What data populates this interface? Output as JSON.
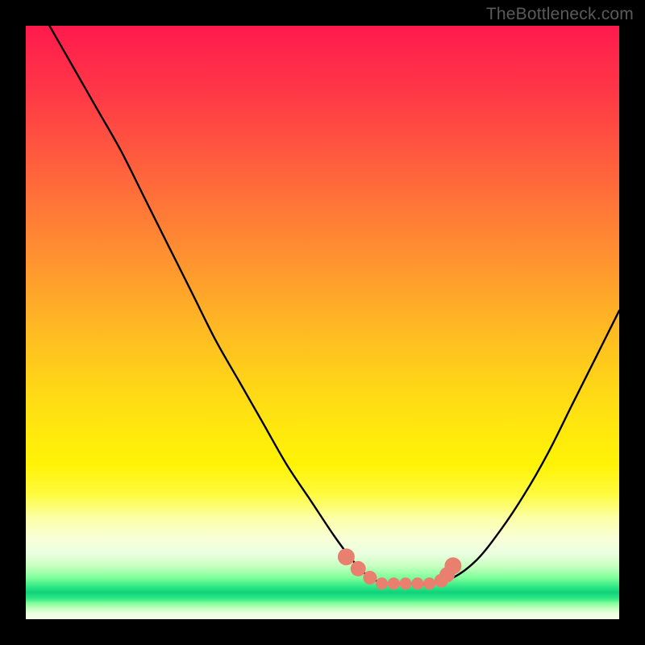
{
  "watermark": "TheBottleneck.com",
  "colors": {
    "frame": "#000000",
    "gradient_top": "#ff1a4d",
    "gradient_mid": "#ffe80e",
    "gradient_green": "#10d27a",
    "curve_stroke": "#000000",
    "dot_fill": "#e9806f"
  },
  "chart_data": {
    "type": "line",
    "title": "",
    "xlabel": "",
    "ylabel": "",
    "xlim": [
      0,
      100
    ],
    "ylim": [
      0,
      100
    ],
    "grid": false,
    "series": [
      {
        "name": "bottleneck-curve",
        "x": [
          4,
          8,
          12,
          16,
          20,
          24,
          28,
          32,
          36,
          40,
          44,
          48,
          52,
          55,
          58,
          61,
          63,
          65,
          68,
          72,
          76,
          80,
          84,
          88,
          92,
          96,
          100
        ],
        "y": [
          100,
          93,
          86,
          79,
          71,
          63,
          55,
          47,
          40,
          33,
          26,
          20,
          14,
          10,
          7,
          6,
          6,
          6,
          6,
          7,
          10,
          15,
          21,
          28,
          36,
          44,
          52
        ]
      }
    ],
    "marker_points": {
      "name": "highlight-dots",
      "x": [
        54,
        56,
        58,
        60,
        62,
        64,
        66,
        68,
        70,
        71,
        72
      ],
      "y": [
        10.5,
        8.5,
        7,
        6,
        6,
        6,
        6,
        6,
        6.5,
        7.5,
        9
      ]
    }
  }
}
